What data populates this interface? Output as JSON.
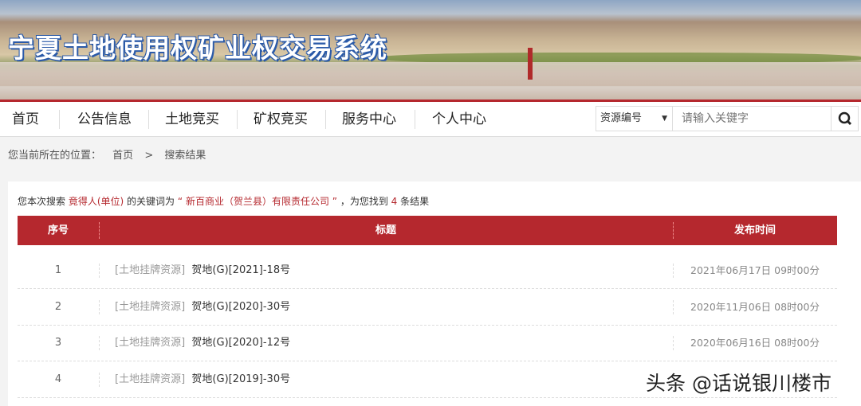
{
  "header": {
    "site_title": "宁夏土地使用权矿业权交易系统"
  },
  "nav": {
    "items": [
      "首页",
      "公告信息",
      "土地竞买",
      "矿权竞买",
      "服务中心",
      "个人中心"
    ]
  },
  "search": {
    "type_selected": "资源编号",
    "placeholder": "请输入关键字"
  },
  "breadcrumb": {
    "prefix": "您当前所在的位置：",
    "home": "首页",
    "sep": ">",
    "current": "搜索结果"
  },
  "summary": {
    "p1": "您本次搜索",
    "field": "竟得人(单位)",
    "p2": "的关键词为",
    "q1": "“",
    "keyword": "新百商业（贺兰县）有限责任公司",
    "q2": "”",
    "p3": "，为您找到",
    "count": "4",
    "p4": "条结果"
  },
  "table": {
    "headers": [
      "序号",
      "标题",
      "发布时间"
    ],
    "rows": [
      {
        "no": "1",
        "category": "[土地挂牌资源]",
        "title": "贺地(G)[2021]-18号",
        "date": "2021年06月17日 09时00分"
      },
      {
        "no": "2",
        "category": "[土地挂牌资源]",
        "title": "贺地(G)[2020]-30号",
        "date": "2020年11月06日 08时00分"
      },
      {
        "no": "3",
        "category": "[土地挂牌资源]",
        "title": "贺地(G)[2020]-12号",
        "date": "2020年06月16日 08时00分"
      },
      {
        "no": "4",
        "category": "[土地挂牌资源]",
        "title": "贺地(G)[2019]-30号",
        "date": ""
      }
    ]
  },
  "watermark": "头条 @话说银川楼市"
}
